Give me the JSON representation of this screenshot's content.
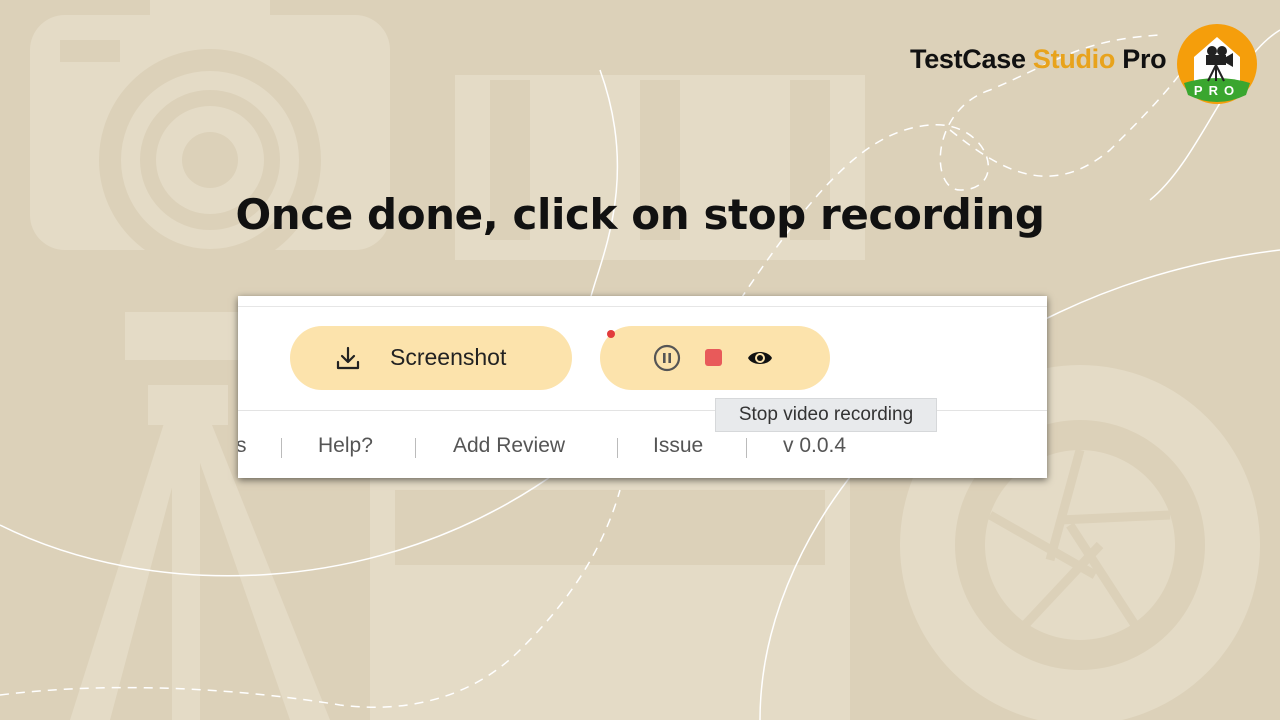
{
  "brand": {
    "name_part1": "TestCase",
    "name_accent": "Studio",
    "name_part3": "Pro",
    "badge_text": "PRO",
    "accent_color": "#e8a31c"
  },
  "headline": "Once done, click on stop recording",
  "panel": {
    "screenshot_button": {
      "label": "Screenshot",
      "icon": "download-icon"
    },
    "recording_controls": {
      "pause_icon": "pause-circle-icon",
      "stop_icon": "stop-square-icon",
      "preview_icon": "eye-icon"
    },
    "tooltip": "Stop video recording",
    "footer_links": [
      "s",
      "Help?",
      "Add Review",
      "Issue",
      "v 0.0.4"
    ]
  },
  "colors": {
    "background": "#dcd1b9",
    "button_fill": "#fce3ac",
    "stop_red": "#e85a5a"
  }
}
